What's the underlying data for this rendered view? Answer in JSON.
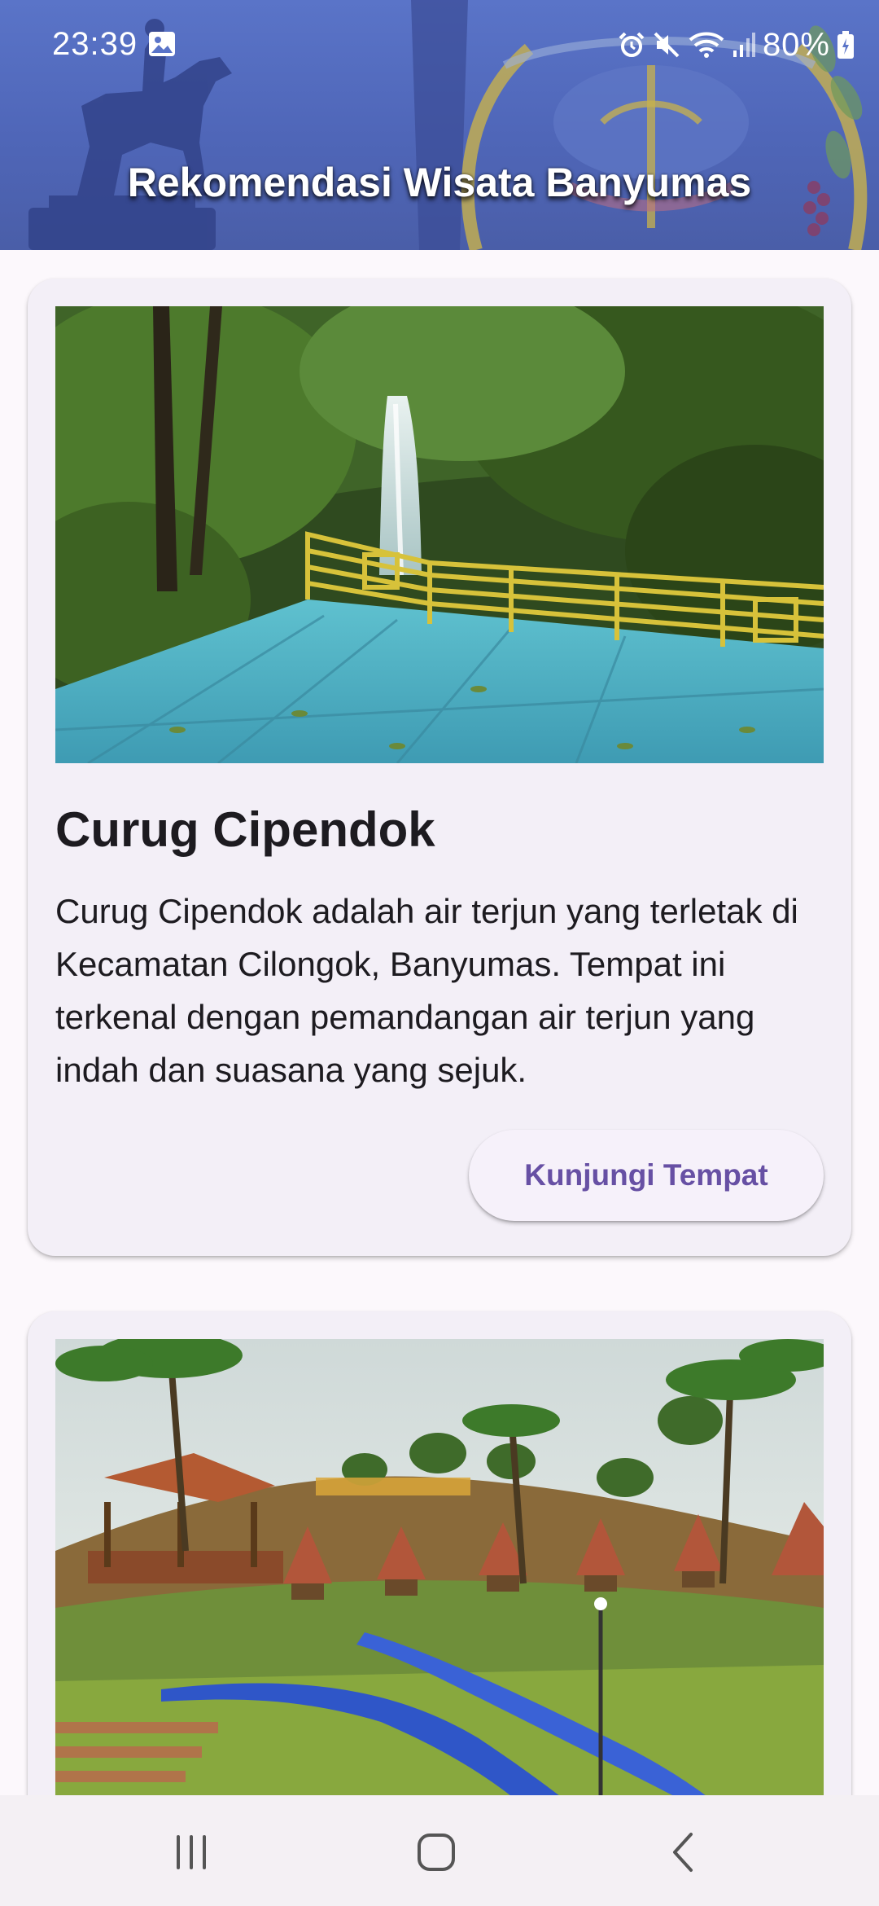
{
  "status_bar": {
    "time": "23:39",
    "battery": "80%",
    "icons": [
      "gallery-icon",
      "alarm-icon",
      "mute-icon",
      "wifi-icon",
      "signal-icon",
      "battery-icon"
    ]
  },
  "header": {
    "title": "Rekomendasi Wisata Banyumas"
  },
  "places": [
    {
      "title": "Curug Cipendok",
      "description": "Curug Cipendok adalah air terjun yang terletak di Kecamatan Cilongok, Banyumas. Tempat ini terkenal dengan pemandangan air terjun yang indah dan suasana yang sejuk.",
      "button_label": "Kunjungi Tempat",
      "image": "waterfall with yellow railing viewing deck"
    },
    {
      "image": "hillside resort with huts, palm trees and blue slides"
    }
  ],
  "nav": {
    "recents": "recents-icon",
    "home": "home-icon",
    "back": "back-icon"
  },
  "colors": {
    "header_blue": "#5a74c8",
    "card_bg": "#f3eff7",
    "accent": "#6750a4",
    "page_bg": "#fcf8fc"
  }
}
